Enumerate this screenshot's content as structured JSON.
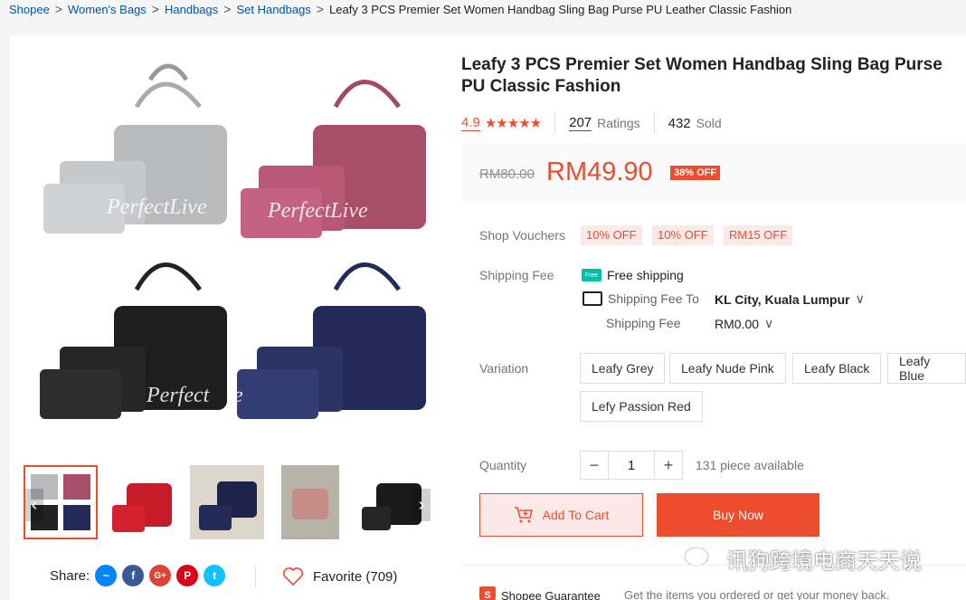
{
  "breadcrumb": {
    "items": [
      "Shopee",
      "Women's Bags",
      "Handbags",
      "Set Handbags"
    ],
    "current": "Leafy 3 PCS Premier Set Women Handbag Sling Bag Purse PU Leather Classic Fashion"
  },
  "gallery": {
    "watermark": "PerfectLive",
    "watermark_partial_left": "Perfect",
    "watermark_partial_right": "e",
    "prev_icon": "chevron-left-icon",
    "next_icon": "chevron-right-icon"
  },
  "share": {
    "label": "Share:",
    "icons": [
      "messenger-icon",
      "facebook-icon",
      "google-plus-icon",
      "pinterest-icon",
      "twitter-icon"
    ],
    "glyphs": {
      "messenger": "~",
      "facebook": "f",
      "googleplus": "G+",
      "pinterest": "P",
      "twitter": "t"
    }
  },
  "favorite": {
    "label": "Favorite (709)"
  },
  "product": {
    "title": "Leafy 3 PCS Premier Set Women Handbag Sling Bag Purse PU Classic Fashion",
    "rating": "4.9",
    "stars": "★★★★★",
    "ratings_count": "207",
    "ratings_label": "Ratings",
    "sold_count": "432",
    "sold_label": "Sold"
  },
  "price": {
    "original": "RM80.00",
    "current": "RM49.90",
    "discount": "38% OFF"
  },
  "vouchers": {
    "label": "Shop Vouchers",
    "items": [
      "10% OFF",
      "10% OFF",
      "RM15 OFF"
    ]
  },
  "shipping": {
    "label": "Shipping Fee",
    "free_badge": "Free",
    "free_text": "Free shipping",
    "fee_to_label": "Shipping Fee To",
    "location": "KL City, Kuala Lumpur",
    "fee_label": "Shipping Fee",
    "fee_value": "RM0.00",
    "chevron": "∨"
  },
  "variation": {
    "label": "Variation",
    "options": [
      "Leafy Grey",
      "Leafy Nude Pink",
      "Leafy Black",
      "Leafy Blue",
      "Lefy Passion Red"
    ]
  },
  "quantity": {
    "label": "Quantity",
    "minus": "−",
    "value": "1",
    "plus": "+",
    "available": "131 piece available"
  },
  "actions": {
    "add_to_cart": "Add To Cart",
    "buy_now": "Buy Now"
  },
  "guarantee": {
    "label": "Shopee Guarantee",
    "badge": "S",
    "description": "Get the items you ordered or get your money back."
  },
  "wechat_watermark": "讯狗跨境电商天天说",
  "colors": {
    "accent": "#ee4d2d",
    "voucher_bg": "#fbe9e7"
  }
}
